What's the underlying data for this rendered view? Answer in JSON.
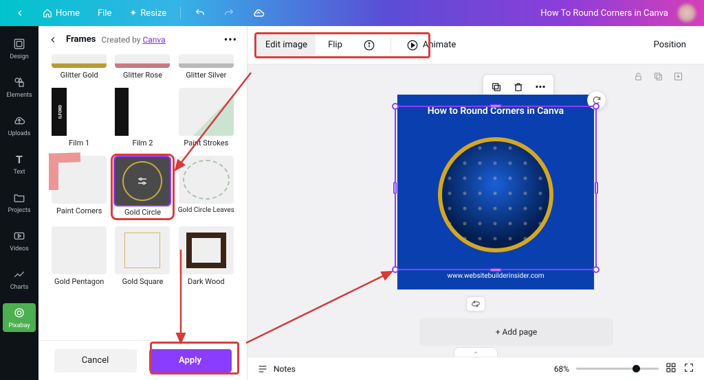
{
  "topbar": {
    "home": "Home",
    "file": "File",
    "resize": "Resize",
    "doc_title": "How To Round Corners in Canva"
  },
  "sidebar": {
    "items": [
      {
        "label": "Design",
        "icon": "design"
      },
      {
        "label": "Elements",
        "icon": "elements"
      },
      {
        "label": "Uploads",
        "icon": "uploads"
      },
      {
        "label": "Text",
        "icon": "text"
      },
      {
        "label": "Projects",
        "icon": "projects"
      },
      {
        "label": "Videos",
        "icon": "videos"
      },
      {
        "label": "Charts",
        "icon": "charts"
      },
      {
        "label": "Pixabay",
        "icon": "pixabay"
      }
    ]
  },
  "panel": {
    "title": "Frames",
    "created_by_prefix": "Created by ",
    "created_by_link": "Canva",
    "items": [
      {
        "label": "Glitter Gold"
      },
      {
        "label": "Glitter Rose"
      },
      {
        "label": "Glitter Silver"
      },
      {
        "label": "Film 1"
      },
      {
        "label": "Film 2"
      },
      {
        "label": "Paint Strokes"
      },
      {
        "label": "Paint Corners"
      },
      {
        "label": "Gold Circle"
      },
      {
        "label": "Gold Circle Leaves"
      },
      {
        "label": "Gold Pentagon"
      },
      {
        "label": "Gold Square"
      },
      {
        "label": "Dark Wood"
      }
    ],
    "cancel": "Cancel",
    "apply": "Apply"
  },
  "contextbar": {
    "edit_image": "Edit image",
    "flip": "Flip",
    "animate": "Animate",
    "position": "Position"
  },
  "canvas": {
    "heading": "How to Round Corners in Canva",
    "site": "www.websitebuilderinsider.com",
    "add_page": "+ Add page"
  },
  "footer": {
    "notes": "Notes",
    "zoom_value": "68%"
  }
}
